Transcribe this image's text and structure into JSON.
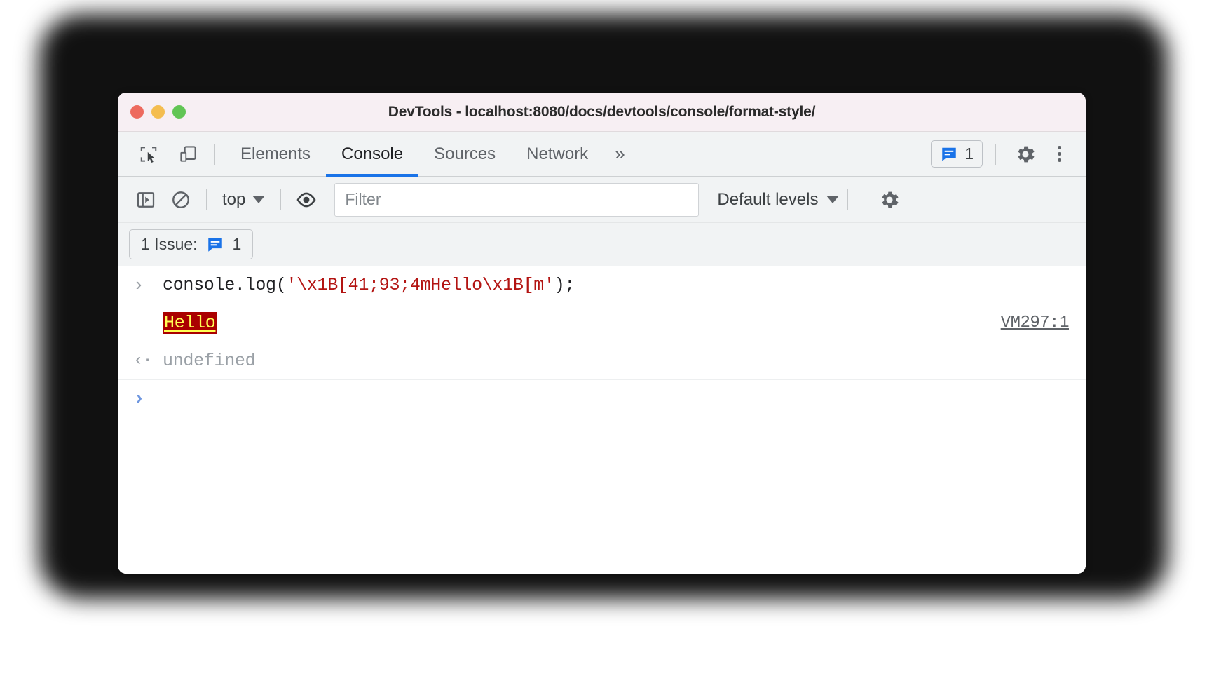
{
  "window": {
    "title": "DevTools - localhost:8080/docs/devtools/console/format-style/",
    "traffic_lights": {
      "close": "close",
      "minimize": "minimize",
      "zoom": "zoom"
    }
  },
  "tabbar": {
    "inspect_icon": "inspect-element-icon",
    "device_icon": "device-toolbar-icon",
    "tabs": [
      {
        "label": "Elements",
        "active": false
      },
      {
        "label": "Console",
        "active": true
      },
      {
        "label": "Sources",
        "active": false
      },
      {
        "label": "Network",
        "active": false
      }
    ],
    "more_tabs": "»",
    "issues_badge": {
      "icon": "issues-speech-bubble-icon",
      "count": "1"
    },
    "settings_icon": "gear-icon",
    "menu_icon": "kebab-menu-icon"
  },
  "console_toolbar": {
    "sidebar_toggle_icon": "console-sidebar-icon",
    "clear_icon": "clear-console-icon",
    "context": {
      "label": "top",
      "caret": "▼"
    },
    "eye_icon": "live-expression-eye-icon",
    "filter": {
      "value": "",
      "placeholder": "Filter"
    },
    "levels": {
      "label": "Default levels",
      "caret": "▼"
    },
    "settings_icon": "console-settings-gear-icon"
  },
  "issues_bar": {
    "label": "1 Issue:",
    "icon": "issues-speech-bubble-icon",
    "count": "1"
  },
  "console": {
    "rows": [
      {
        "type": "input",
        "marker": "›",
        "code_prefix": "console.log(",
        "code_string": "'\\x1B[41;93;4mHello\\x1B[m'",
        "code_suffix": ");"
      },
      {
        "type": "output",
        "text": "Hello",
        "source": "VM297:1",
        "style": {
          "background": "#aa0000",
          "color": "#ffff55",
          "underline": true
        }
      },
      {
        "type": "result",
        "marker": "‹·",
        "text": "undefined"
      },
      {
        "type": "prompt",
        "marker": "›"
      }
    ]
  },
  "colors": {
    "accent": "#1a73e8",
    "string_literal": "#b31412",
    "ansi_bg": "#aa0000",
    "ansi_fg": "#ffff55",
    "titlebar_bg": "#f7eff3"
  }
}
